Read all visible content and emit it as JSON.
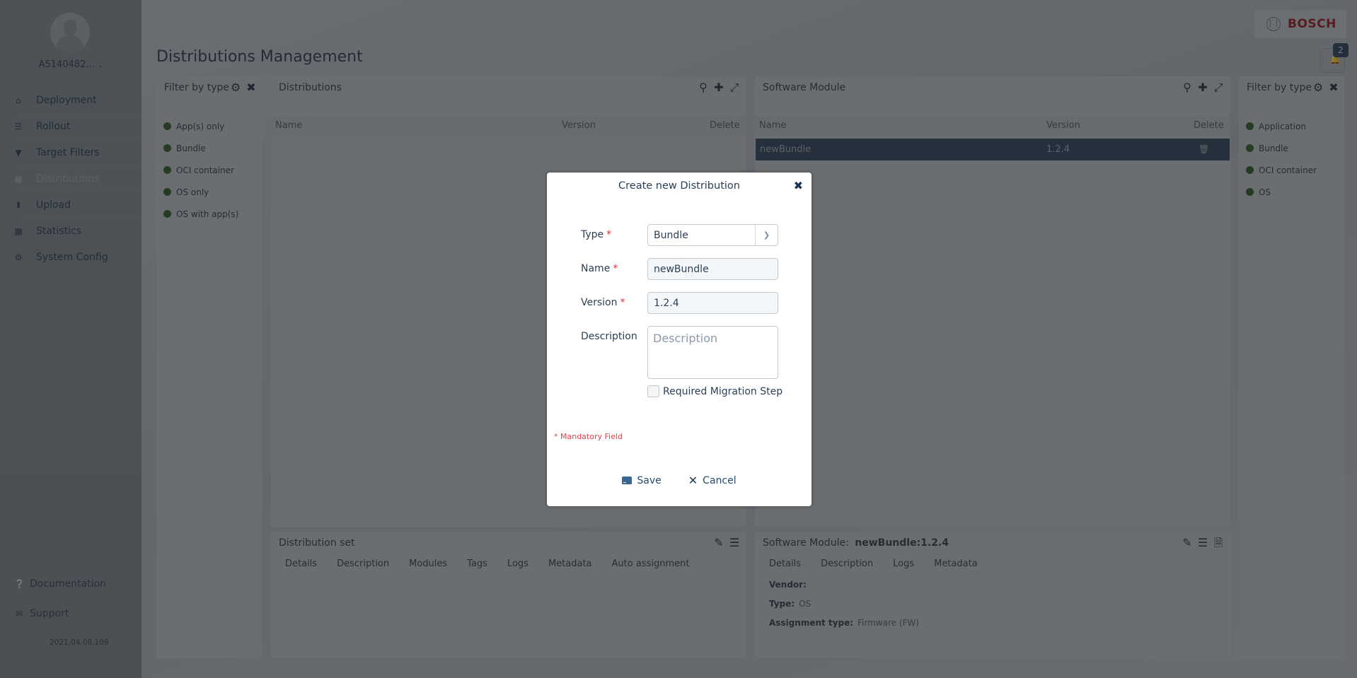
{
  "sidebar": {
    "user": "A5140482...",
    "nav": [
      {
        "label": "Deployment",
        "icon": "home-icon"
      },
      {
        "label": "Rollout",
        "icon": "list-icon"
      },
      {
        "label": "Target Filters",
        "icon": "filter-icon"
      },
      {
        "label": "Distributions",
        "icon": "briefcase-icon",
        "active": true
      },
      {
        "label": "Upload",
        "icon": "upload-icon"
      },
      {
        "label": "Statistics",
        "icon": "bar-chart-icon"
      },
      {
        "label": "System Config",
        "icon": "gear-icon"
      }
    ],
    "footer": [
      {
        "label": "Documentation",
        "icon": "question-circle-icon"
      },
      {
        "label": "Support",
        "icon": "envelope-icon"
      }
    ],
    "version": "2021.04.08.109"
  },
  "header": {
    "brand": "BOSCH",
    "notifications_count": "2",
    "page_title": "Distributions Management"
  },
  "left_filter": {
    "title": "Filter by type",
    "items": [
      "App(s) only",
      "Bundle",
      "OCI container",
      "OS only",
      "OS with app(s)"
    ]
  },
  "distributions": {
    "title": "Distributions",
    "columns": [
      "Name",
      "Version",
      "Delete"
    ],
    "rows": []
  },
  "software_module": {
    "title": "Software Module",
    "columns": [
      "Name",
      "Version",
      "Delete"
    ],
    "rows": [
      {
        "name": "newBundle",
        "version": "1.2.4",
        "selected": true
      }
    ]
  },
  "right_filter": {
    "title": "Filter by type",
    "items": [
      "Application",
      "Bundle",
      "OCI container",
      "OS"
    ]
  },
  "distribution_set": {
    "title": "Distribution set",
    "tabs": [
      "Details",
      "Description",
      "Modules",
      "Tags",
      "Logs",
      "Metadata",
      "Auto assignment"
    ]
  },
  "sm_details": {
    "title_prefix": "Software Module:",
    "title_value": "newBundle:1.2.4",
    "tabs": [
      "Details",
      "Description",
      "Logs",
      "Metadata"
    ],
    "fields": [
      {
        "label": "Vendor:",
        "value": ""
      },
      {
        "label": "Type:",
        "value": "OS"
      },
      {
        "label": "Assignment type:",
        "value": "Firmware (FW)"
      }
    ]
  },
  "dialog": {
    "title": "Create new Distribution",
    "type_label": "Type",
    "type_value": "Bundle",
    "name_label": "Name",
    "name_value": "newBundle",
    "version_label": "Version",
    "version_value": "1.2.4",
    "description_label": "Description",
    "description_placeholder": "Description",
    "description_value": "",
    "required_marker": "*",
    "migration_label": "Required Migration Step",
    "migration_checked": false,
    "mandatory_note": "* Mandatory Field",
    "save_label": "Save",
    "cancel_label": "Cancel"
  },
  "colors": {
    "brand_red": "#e20015",
    "selected_row": "#1e3a5a",
    "filter_dot": "#3a8a2e",
    "required": "#e0303a"
  }
}
